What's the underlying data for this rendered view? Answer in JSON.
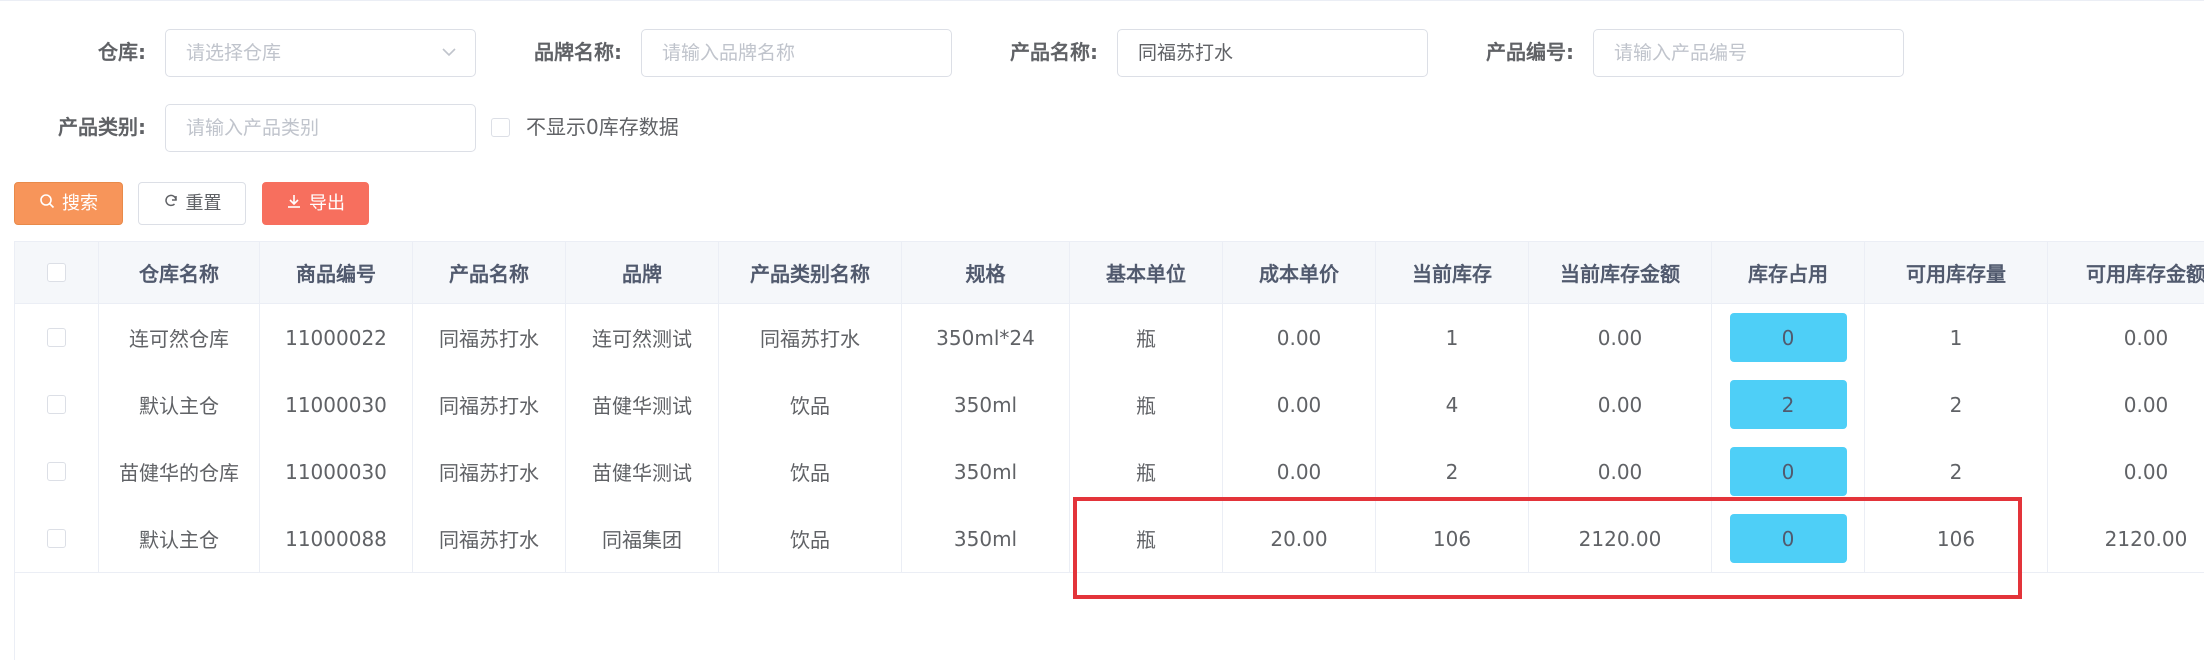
{
  "filters": {
    "warehouse": {
      "label": "仓库:",
      "placeholder": "请选择仓库"
    },
    "brand": {
      "label": "品牌名称:",
      "placeholder": "请输入品牌名称"
    },
    "product_name": {
      "label": "产品名称:",
      "value": "同福苏打水"
    },
    "product_code": {
      "label": "产品编号:",
      "placeholder": "请输入产品编号"
    },
    "category": {
      "label": "产品类别:",
      "placeholder": "请输入产品类别"
    },
    "hide_zero": {
      "label": "不显示0库存数据",
      "checked": false
    }
  },
  "actions": {
    "search": "搜索",
    "reset": "重置",
    "export": "导出"
  },
  "table": {
    "columns": [
      "仓库名称",
      "商品编号",
      "产品名称",
      "品牌",
      "产品类别名称",
      "规格",
      "基本单位",
      "成本单价",
      "当前库存",
      "当前库存金额",
      "库存占用",
      "可用库存量",
      "可用库存金额"
    ],
    "rows": [
      [
        "连可然仓库",
        "11000022",
        "同福苏打水",
        "连可然测试",
        "同福苏打水",
        "350ml*24",
        "瓶",
        "0.00",
        "1",
        "0.00",
        "0",
        "1",
        "0.00"
      ],
      [
        "默认主仓",
        "11000030",
        "同福苏打水",
        "苗健华测试",
        "饮品",
        "350ml",
        "瓶",
        "0.00",
        "4",
        "0.00",
        "2",
        "2",
        "0.00"
      ],
      [
        "苗健华的仓库",
        "11000030",
        "同福苏打水",
        "苗健华测试",
        "饮品",
        "350ml",
        "瓶",
        "0.00",
        "2",
        "0.00",
        "0",
        "2",
        "0.00"
      ],
      [
        "默认主仓",
        "11000088",
        "同福苏打水",
        "同福集团",
        "饮品",
        "350ml",
        "瓶",
        "20.00",
        "106",
        "2120.00",
        "0",
        "106",
        "2120.00"
      ]
    ]
  },
  "colors": {
    "search_button": "#f7955a",
    "export_button": "#f76f5e",
    "occupancy_badge": "#4ecff7",
    "highlight_box": "#e3343a"
  }
}
